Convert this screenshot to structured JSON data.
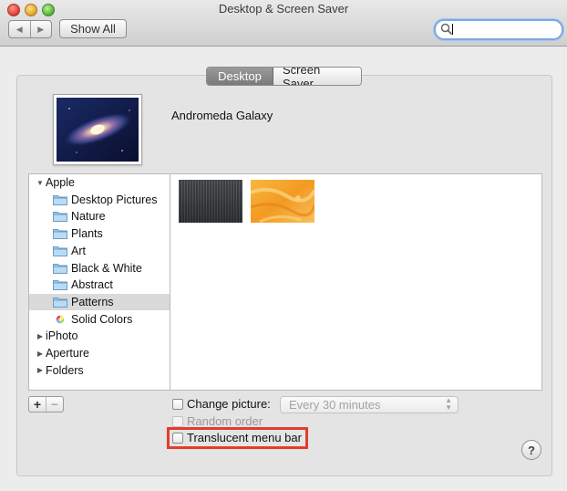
{
  "window": {
    "title": "Desktop & Screen Saver"
  },
  "toolbar": {
    "back_icon": "chevron-left-icon",
    "forward_icon": "chevron-right-icon",
    "show_all_label": "Show All",
    "search": {
      "value": "",
      "placeholder": "",
      "icon": "search-icon"
    }
  },
  "tabs": [
    {
      "label": "Desktop",
      "active": true
    },
    {
      "label": "Screen Saver",
      "active": false
    }
  ],
  "current_wallpaper": {
    "name": "Andromeda Galaxy"
  },
  "source_list": {
    "groups": [
      {
        "label": "Apple",
        "expanded": true,
        "items": [
          {
            "label": "Desktop Pictures",
            "icon": "folder-icon"
          },
          {
            "label": "Nature",
            "icon": "folder-icon"
          },
          {
            "label": "Plants",
            "icon": "folder-icon"
          },
          {
            "label": "Art",
            "icon": "folder-icon"
          },
          {
            "label": "Black & White",
            "icon": "folder-icon"
          },
          {
            "label": "Abstract",
            "icon": "folder-icon"
          },
          {
            "label": "Patterns",
            "icon": "folder-icon",
            "selected": true
          },
          {
            "label": "Solid Colors",
            "icon": "color-wheel-icon"
          }
        ]
      },
      {
        "label": "iPhoto",
        "expanded": false
      },
      {
        "label": "Aperture",
        "expanded": false
      },
      {
        "label": "Folders",
        "expanded": false
      }
    ]
  },
  "thumbnails": [
    {
      "name": "dark-stripes-pattern",
      "colors": [
        "#3a3d3e",
        "#5a5e60"
      ]
    },
    {
      "name": "orange-texture-pattern",
      "colors": [
        "#f0a02a",
        "#f7c25a"
      ]
    }
  ],
  "bottom": {
    "add_label": "+",
    "remove_label": "−",
    "change_picture": {
      "label": "Change picture:",
      "checked": false
    },
    "interval": {
      "value": "Every 30 minutes",
      "enabled": false
    },
    "random_order": {
      "label": "Random order",
      "checked": false,
      "enabled": false
    },
    "translucent_menu_bar": {
      "label": "Translucent menu bar",
      "checked": false
    },
    "help_label": "?"
  },
  "colors": {
    "highlight": "#e43c2c",
    "selection": "#dadada"
  }
}
